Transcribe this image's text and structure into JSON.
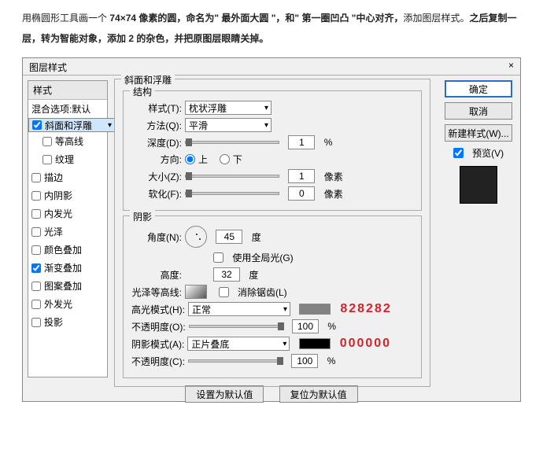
{
  "article": {
    "p1a": "用椭圆形工具画一个 ",
    "p1b": "74×74 像素的圆，命名为\" 最外面大圆 \"，和\" 第一圈凹凸 \"中心对齐，",
    "p1c": "添加图层样式。",
    "p1d": "之后复制一层，转为智能对象，添加 2 的杂色，并把原图层眼睛关掉。"
  },
  "dialog": {
    "title": "图层样式",
    "left": {
      "header": "样式",
      "blend": "混合选项:默认",
      "items": [
        {
          "label": "斜面和浮雕",
          "checked": true,
          "sel": true
        },
        {
          "label": "等高线",
          "checked": false,
          "sub": true
        },
        {
          "label": "纹理",
          "checked": false,
          "sub": true
        },
        {
          "label": "描边",
          "checked": false
        },
        {
          "label": "内阴影",
          "checked": false
        },
        {
          "label": "内发光",
          "checked": false
        },
        {
          "label": "光泽",
          "checked": false
        },
        {
          "label": "颜色叠加",
          "checked": false
        },
        {
          "label": "渐变叠加",
          "checked": true
        },
        {
          "label": "图案叠加",
          "checked": false
        },
        {
          "label": "外发光",
          "checked": false
        },
        {
          "label": "投影",
          "checked": false
        }
      ]
    },
    "bevel": {
      "title": "斜面和浮雕",
      "struct_title": "结构",
      "style_label": "样式(T):",
      "style_value": "枕状浮雕",
      "method_label": "方法(Q):",
      "method_value": "平滑",
      "depth_label": "深度(D):",
      "depth_value": "1",
      "pct": "%",
      "dir_label": "方向:",
      "dir_up": "上",
      "dir_down": "下",
      "size_label": "大小(Z):",
      "size_value": "1",
      "px": "像素",
      "soft_label": "软化(F):",
      "soft_value": "0",
      "shade_title": "阴影",
      "angle_label": "角度(N):",
      "angle_value": "45",
      "deg": "度",
      "global_label": "使用全局光(G)",
      "alt_label": "高度:",
      "alt_value": "32",
      "contour_label": "光泽等高线:",
      "aa_label": "消除锯齿(L)",
      "hmode_label": "高光模式(H):",
      "hmode_value": "正常",
      "hcolor": "828282",
      "hopacity_label": "不透明度(O):",
      "hopacity_value": "100",
      "smode_label": "阴影模式(A):",
      "smode_value": "正片叠底",
      "scolor": "000000",
      "sopacity_label": "不透明度(C):",
      "sopacity_value": "100"
    },
    "buttons": {
      "ok": "确定",
      "cancel": "取消",
      "newstyle": "新建样式(W)...",
      "preview": "预览(V)",
      "default1": "设置为默认值",
      "default2": "复位为默认值"
    }
  }
}
